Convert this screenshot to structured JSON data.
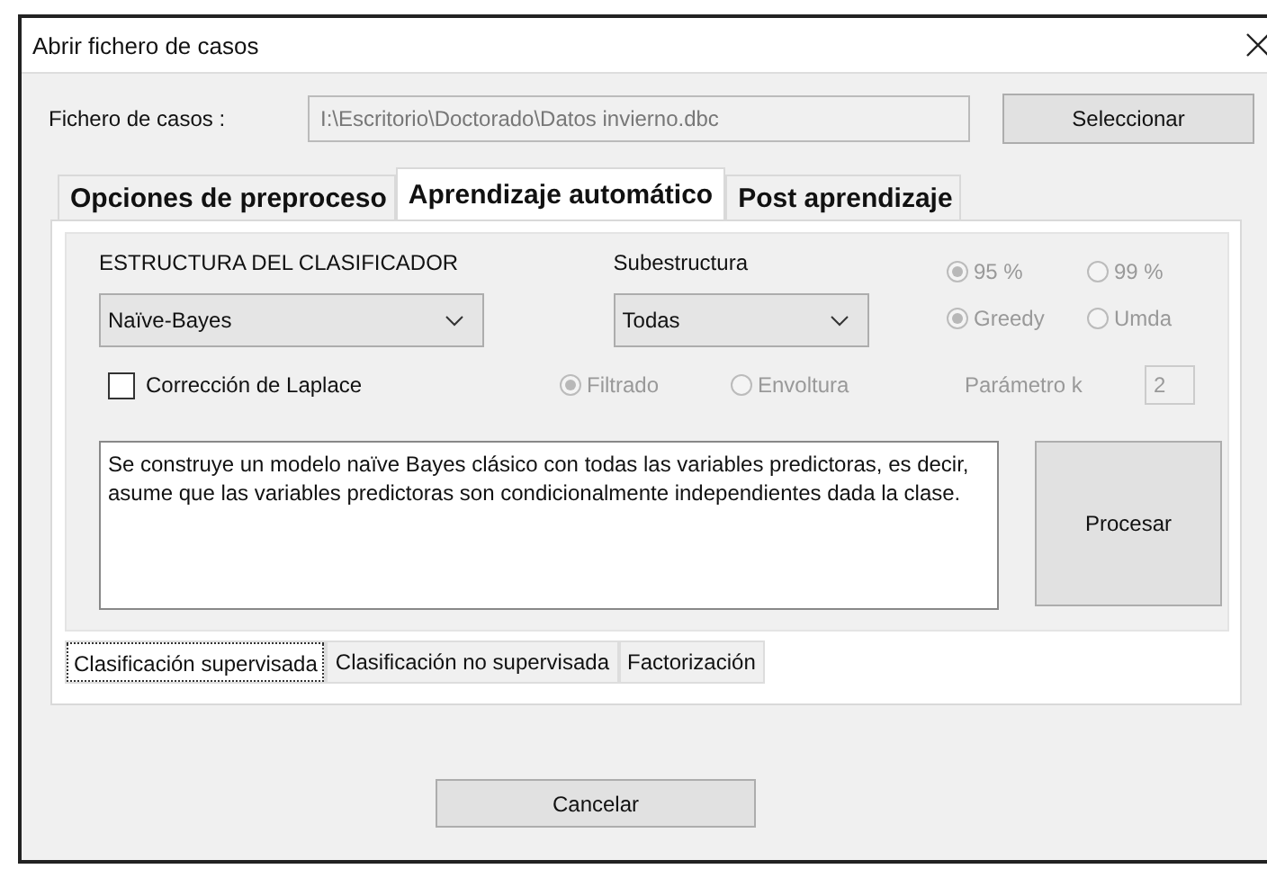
{
  "window": {
    "title": "Abrir fichero de casos"
  },
  "file": {
    "label": "Fichero de casos :",
    "value": "I:\\Escritorio\\Doctorado\\Datos invierno.dbc",
    "button": "Seleccionar"
  },
  "tabs": [
    {
      "label": "Opciones de preproceso",
      "selected": false
    },
    {
      "label": "Aprendizaje automático",
      "selected": true
    },
    {
      "label": "Post aprendizaje",
      "selected": false
    }
  ],
  "structure": {
    "label": "ESTRUCTURA DEL CLASIFICADOR",
    "value": "Naïve-Bayes"
  },
  "substructure": {
    "label": "Subestructura",
    "value": "Todas"
  },
  "confidence": [
    {
      "label": "95 %",
      "selected": true,
      "disabled": true
    },
    {
      "label": "99 %",
      "selected": false,
      "disabled": true
    }
  ],
  "search": [
    {
      "label": "Greedy",
      "selected": true,
      "disabled": true
    },
    {
      "label": "Umda",
      "selected": false,
      "disabled": true
    }
  ],
  "laplace": {
    "label": "Corrección de Laplace",
    "checked": false
  },
  "method": [
    {
      "label": "Filtrado",
      "selected": true,
      "disabled": true
    },
    {
      "label": "Envoltura",
      "selected": false,
      "disabled": true
    }
  ],
  "param_k": {
    "label": "Parámetro k",
    "value": "2",
    "disabled": true
  },
  "description": "Se construye un modelo naïve Bayes clásico con todas las variables predictoras, es decir, asume que las variables predictoras son condicionalmente independientes dada la clase.",
  "process_button": "Procesar",
  "subtabs": [
    {
      "label": "Clasificación supervisada",
      "selected": true
    },
    {
      "label": "Clasificación no supervisada",
      "selected": false
    },
    {
      "label": "Factorización",
      "selected": false
    }
  ],
  "cancel_button": "Cancelar"
}
